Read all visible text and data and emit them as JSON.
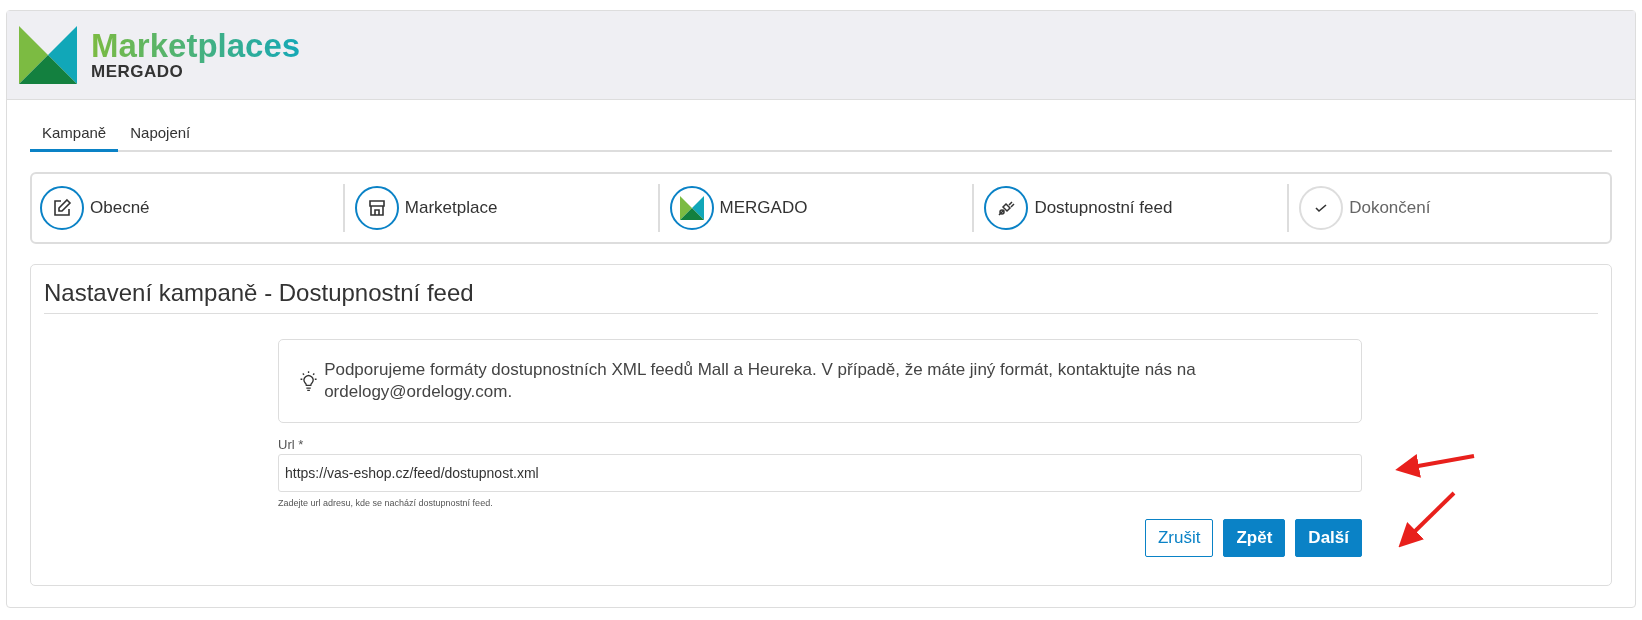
{
  "header": {
    "product": "Marketplaces",
    "brand": "MERGADO"
  },
  "tabs": [
    {
      "label": "Kampaně",
      "selected": true
    },
    {
      "label": "Napojení",
      "selected": false
    }
  ],
  "steps": [
    {
      "label": "Obecné",
      "kind": "edit",
      "active": true
    },
    {
      "label": "Marketplace",
      "kind": "store",
      "active": true
    },
    {
      "label": "MERGADO",
      "kind": "logo",
      "active": true
    },
    {
      "label": "Dostupnostní feed",
      "kind": "plug",
      "active": true
    },
    {
      "label": "Dokončení",
      "kind": "check",
      "active": false
    }
  ],
  "form": {
    "title": "Nastavení kampaně - Dostupnostní feed",
    "info": "Podporujeme formáty dostupnostních XML feedů Mall a Heureka. V případě, že máte jiný formát, kontaktujte nás na ordelogy@ordelogy.com.",
    "url_label": "Url *",
    "url_value": "https://vas-eshop.cz/feed/dostupnost.xml",
    "url_hint": "Zadejte url adresu, kde se nachází dostupnostní feed.",
    "buttons": [
      {
        "label": "Zrušit",
        "kind": "outline"
      },
      {
        "label": "Zpět",
        "kind": "primary"
      },
      {
        "label": "Další",
        "kind": "primary"
      }
    ]
  }
}
